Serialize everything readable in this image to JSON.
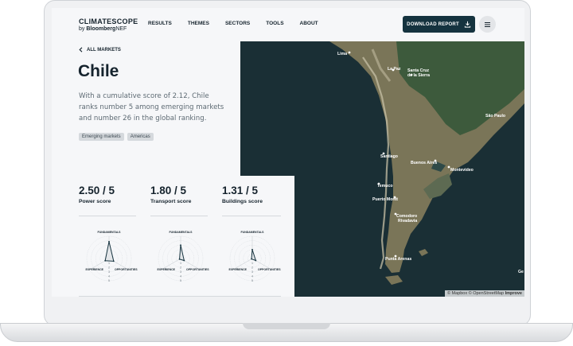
{
  "header": {
    "logo_main": "CLIMATESCOPE",
    "logo_by": "by",
    "logo_bold": "Bloomberg",
    "logo_rest": "NEF",
    "nav": [
      "RESULTS",
      "THEMES",
      "SECTORS",
      "TOOLS",
      "ABOUT"
    ],
    "download_label": "DOWNLOAD REPORT"
  },
  "page": {
    "back_label": "ALL MARKETS",
    "title": "Chile",
    "description": "With a cumulative score of 2.12, Chile ranks number 5 among emerging markets and number 26 in the global ranking.",
    "tags": [
      "Emerging markets",
      "Americas"
    ]
  },
  "scores": [
    {
      "value": "2.50 / 5",
      "label": "Power score",
      "fundamentals": 3.8,
      "experience": 1.0,
      "opportunities": 1.2
    },
    {
      "value": "1.80 / 5",
      "label": "Transport score",
      "fundamentals": 3.0,
      "experience": 0.3,
      "opportunities": 0.9
    },
    {
      "value": "1.31 / 5",
      "label": "Buildings score",
      "fundamentals": 2.0,
      "experience": 0.2,
      "opportunities": 0.9
    }
  ],
  "radar": {
    "axis_top": "FUNDAMENTALS",
    "axis_left": "EXPERIENCE",
    "axis_right": "OPPORTUNITIES",
    "ticks": [
      "1",
      "2",
      "3",
      "4",
      "5"
    ]
  },
  "map": {
    "cities": [
      "Lima",
      "La Paz",
      "Santa Cruz de la Sierra",
      "São Paulo",
      "Santiago",
      "Buenos Aires",
      "Montevideo",
      "Temuco",
      "Puerto Montt",
      "Comodoro Rivadavia",
      "Punta Arenas",
      "Ge"
    ],
    "attribution": "© Mapbox © OpenStreetMap",
    "improve": "Improve"
  },
  "colors": {
    "primary": "#15333f",
    "text": "#15232d",
    "ocean": "#1a2f35",
    "land": "#7a7558"
  }
}
